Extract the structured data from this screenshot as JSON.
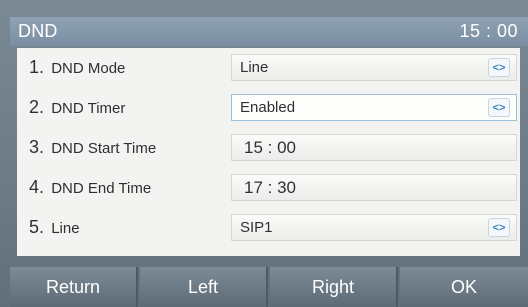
{
  "title_bar": {
    "title": "DND",
    "time": "15 : 00"
  },
  "settings": [
    {
      "num": "1.",
      "label": "DND Mode",
      "value": "Line",
      "arrow": "<>"
    },
    {
      "num": "2.",
      "label": "DND Timer",
      "value": "Enabled",
      "arrow": "<>"
    },
    {
      "num": "3.",
      "label": "DND Start Time",
      "value": "15 : 00"
    },
    {
      "num": "4.",
      "label": "DND End Time",
      "value": "17 : 30"
    },
    {
      "num": "5.",
      "label": "Line",
      "value": "SIP1",
      "arrow": "<>"
    }
  ],
  "softkeys": {
    "return": "Return",
    "left": "Left",
    "right": "Right",
    "ok": "OK"
  },
  "icons": {
    "selector": "left-right-arrows-icon"
  }
}
